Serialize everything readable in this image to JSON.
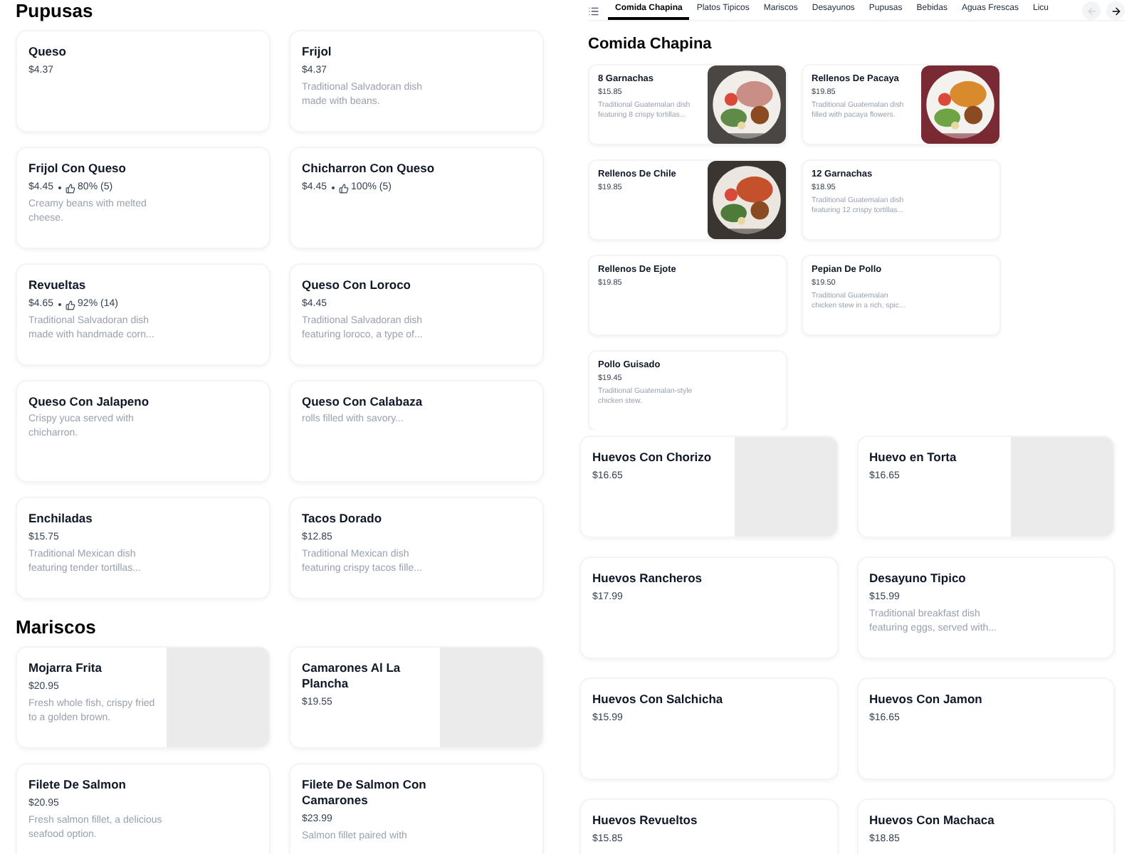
{
  "left_panel": {
    "sections": [
      {
        "title": "Pupusas",
        "items": [
          {
            "name": "Queso",
            "price": "$4.37"
          },
          {
            "name": "Frijol",
            "price": "$4.37",
            "description": "Traditional Salvadoran dish made with beans."
          },
          {
            "name": "Frijol Con Queso",
            "price": "$4.45",
            "rating": "80% (5)",
            "description": "Creamy beans with melted cheese."
          },
          {
            "name": "Chicharron Con Queso",
            "price": "$4.45",
            "rating": "100% (5)"
          },
          {
            "name": "Revueltas",
            "price": "$4.65",
            "rating": "92% (14)",
            "description": "Traditional Salvadoran dish made with handmade corn..."
          },
          {
            "name": "Queso Con Loroco",
            "price": "$4.45",
            "description": "Traditional Salvadoran dish featuring loroco, a type of..."
          },
          {
            "name": "Queso Con Jalapeno",
            "description": "Crispy yuca served with chicharron."
          },
          {
            "name": "Queso Con Calabaza",
            "description": "rolls filled with savory..."
          },
          {
            "name": "Enchiladas",
            "price": "$15.75",
            "description": "Traditional Mexican dish featuring tender tortillas..."
          },
          {
            "name": "Tacos Dorado",
            "price": "$12.85",
            "description": "Traditional Mexican dish featuring crispy tacos fille..."
          }
        ]
      },
      {
        "title": "Mariscos",
        "items": [
          {
            "name": "Mojarra Frita",
            "price": "$20.95",
            "description": "Fresh whole fish, crispy fried to a golden brown.",
            "image": {
              "kind": "placeholder"
            }
          },
          {
            "name": "Camarones Al La Plancha",
            "price": "$19.55",
            "image": {
              "kind": "placeholder"
            }
          },
          {
            "name": "Filete De Salmon",
            "price": "$20.95",
            "description": "Fresh salmon fillet, a delicious seafood option."
          },
          {
            "name": "Filete De Salmon Con Camarones",
            "price": "$23.99",
            "description": "Salmon fillet paired with"
          }
        ]
      }
    ]
  },
  "right_panel": {
    "tabs": [
      {
        "label": "Comida Chapina",
        "selected": true
      },
      {
        "label": "Platos Tipicos",
        "selected": false
      },
      {
        "label": "Mariscos",
        "selected": false
      },
      {
        "label": "Desayunos",
        "selected": false
      },
      {
        "label": "Pupusas",
        "selected": false
      },
      {
        "label": "Bebidas",
        "selected": false
      },
      {
        "label": "Aguas Frescas",
        "selected": false
      },
      {
        "label": "Licu",
        "selected": false
      }
    ],
    "scroll_buttons": [
      {
        "kind": "left",
        "disabled": true
      },
      {
        "kind": "right",
        "disabled": false
      }
    ],
    "section": {
      "title": "Comida Chapina",
      "items": [
        {
          "name": "8 Garnachas",
          "price": "$15.85",
          "description": "Traditional Guatemalan dish featuring 8 crispy tortillas..."
        },
        {
          "name": "Rellenos De Pacaya",
          "price": "$19.85",
          "description": "Traditional Guatemalan dish filled with pacaya flowers."
        },
        {
          "name": "Rellenos De Chile",
          "price": "$19.85"
        },
        {
          "name": "12 Garnachas",
          "price": "$18.95",
          "description": "Traditional Guatemalan dish featuring 12 crispy tortillas..."
        },
        {
          "name": "Rellenos De Ejote",
          "price": "$19.85"
        },
        {
          "name": "Pepian De Pollo",
          "price": "$19.50",
          "description": "Traditional Guatemalan chicken stew in a rich, spic..."
        },
        {
          "name": "Pollo Guisado",
          "price": "$19.45",
          "description": "Traditional Guatemalan-style chicken stew."
        }
      ]
    },
    "lower_items": [
      {
        "name": "Huevos Con Chorizo",
        "price": "$16.65",
        "image": {
          "kind": "placeholder"
        }
      },
      {
        "name": "Huevo en Torta",
        "price": "$16.65",
        "image": {
          "kind": "placeholder"
        }
      },
      {
        "name": "Huevos Rancheros",
        "price": "$17.99"
      },
      {
        "name": "Desayuno Tipico",
        "price": "$15.99",
        "description": "Traditional breakfast dish featuring eggs, served with..."
      },
      {
        "name": "Huevos Con Salchicha",
        "price": "$15.99"
      },
      {
        "name": "Huevos Con Jamon",
        "price": "$16.65"
      },
      {
        "name": "Huevos Revueltos",
        "price": "$15.85"
      },
      {
        "name": "Huevos Con Machaca",
        "price": "$18.85"
      }
    ]
  }
}
